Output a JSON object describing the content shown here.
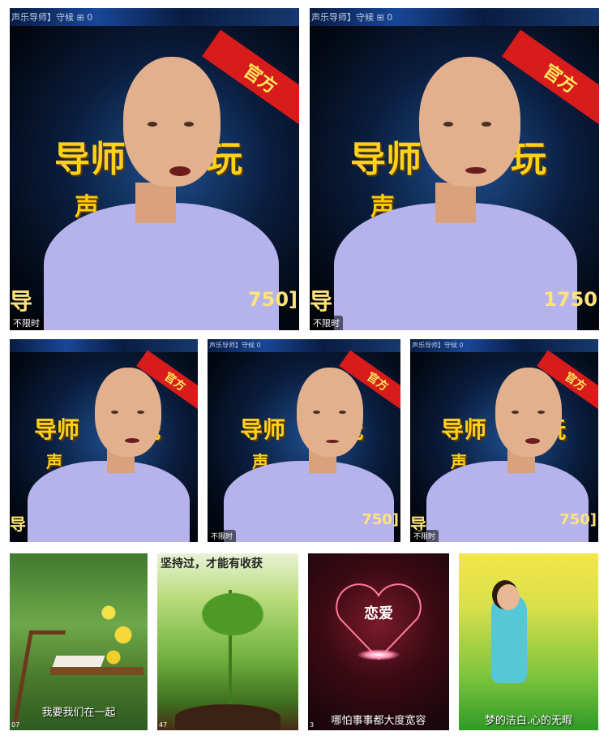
{
  "top_caption": "声乐导师】守候",
  "viewer_count": "0",
  "official_badge": "官方",
  "title_a": "导师",
  "title_b": "玩",
  "title_c": "声",
  "left_edge_text": "导",
  "right_edge_text_a": "750]",
  "right_edge_text_b": "1750",
  "unlimited_label": "不限时",
  "bottom_tiles": [
    {
      "caption": "我要我们在一起",
      "corner": "07"
    },
    {
      "caption": "",
      "corner": "47",
      "top_banner": "坚持过，才能有收获"
    },
    {
      "caption": "哪怕事事都大度宽容",
      "heart_title": "恋爱",
      "corner": "3"
    },
    {
      "caption": "梦的洁白.心的无暇"
    }
  ],
  "colors": {
    "gold_text": "#ffd21a",
    "ribbon": "#d81b1b",
    "shirt": "#b6b3ec"
  }
}
